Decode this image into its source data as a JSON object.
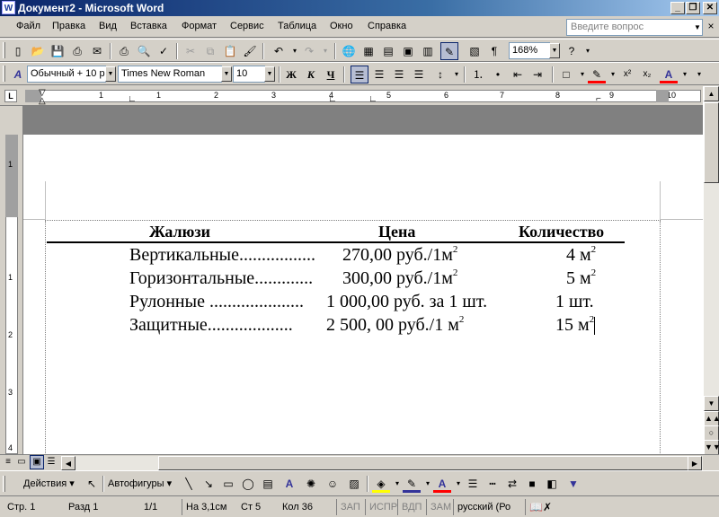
{
  "window": {
    "title": "Документ2 - Microsoft Word",
    "app_icon": "W"
  },
  "menu": {
    "items": [
      "Файл",
      "Правка",
      "Вид",
      "Вставка",
      "Формат",
      "Сервис",
      "Таблица",
      "Окно",
      "Справка"
    ],
    "help_placeholder": "Введите вопрос"
  },
  "standard_toolbar": {
    "zoom": "168%"
  },
  "formatting_toolbar": {
    "style": "Обычный + 10 р",
    "font": "Times New Roman",
    "size": "10",
    "bold": "Ж",
    "italic": "К",
    "underline": "Ч"
  },
  "ruler": {
    "h_numbers": [
      "1",
      "1",
      "2",
      "3",
      "4",
      "5",
      "6",
      "7",
      "8",
      "9",
      "10",
      "11"
    ],
    "v_numbers": [
      "1",
      "1",
      "2",
      "3",
      "4"
    ]
  },
  "document": {
    "headers": [
      "Жалюзи",
      "Цена",
      "Количество"
    ],
    "rows": [
      {
        "name": "Вертикальные",
        "dots": ".................",
        "price": "270,00 руб./1м",
        "sup_price": "2",
        "qty": "4 м",
        "sup_qty": "2"
      },
      {
        "name": "Горизонтальные",
        "dots": ".............",
        "price": "300,00 руб./1м",
        "sup_price": "2",
        "qty": "5 м",
        "sup_qty": "2"
      },
      {
        "name": "Рулонные",
        "dots": " .....................",
        "price": "1 000,00 руб. за 1 шт.",
        "sup_price": "",
        "qty": "1 шт.",
        "sup_qty": ""
      },
      {
        "name": "Защитные",
        "dots": "...................",
        "price": "2 500, 00 руб./1 м",
        "sup_price": "2",
        "qty": "15 м",
        "sup_qty": "2"
      }
    ]
  },
  "drawing_toolbar": {
    "actions": "Действия",
    "autoshapes": "Автофигуры"
  },
  "status": {
    "page": "Стр. 1",
    "section": "Разд 1",
    "pages": "1/1",
    "at": "На 3,1см",
    "line": "Ст 5",
    "col": "Кол 36",
    "rec": "ЗАП",
    "trk": "ИСПР",
    "ext": "ВДП",
    "ovr": "ЗАМ",
    "lang": "русский (Ро"
  }
}
